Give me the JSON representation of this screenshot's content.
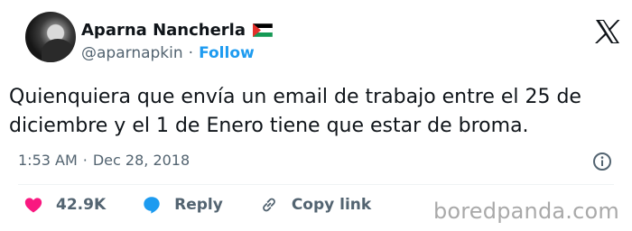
{
  "author": {
    "display_name": "Aparna Nancherla",
    "flag_emoji": "🇵🇸",
    "handle": "@aparnapkin",
    "separator": "·",
    "follow_label": "Follow"
  },
  "tweet": {
    "text": "Quienquiera que envía un email de trabajo entre el 25 de diciembre y el 1 de Enero tiene que estar de broma.",
    "time": "1:53 AM",
    "separator": "·",
    "date": "Dec 28, 2018"
  },
  "actions": {
    "like_count": "42.9K",
    "reply_label": "Reply",
    "copy_link_label": "Copy link"
  },
  "watermark": "boredpanda.com",
  "colors": {
    "accent": "#1d9bf0",
    "like": "#f91880",
    "muted": "#536471",
    "text": "#0f1419"
  },
  "icons": {
    "platform": "x-logo-icon",
    "info": "info-icon",
    "like": "heart-icon",
    "reply": "speech-bubble-icon",
    "copy": "link-icon"
  }
}
